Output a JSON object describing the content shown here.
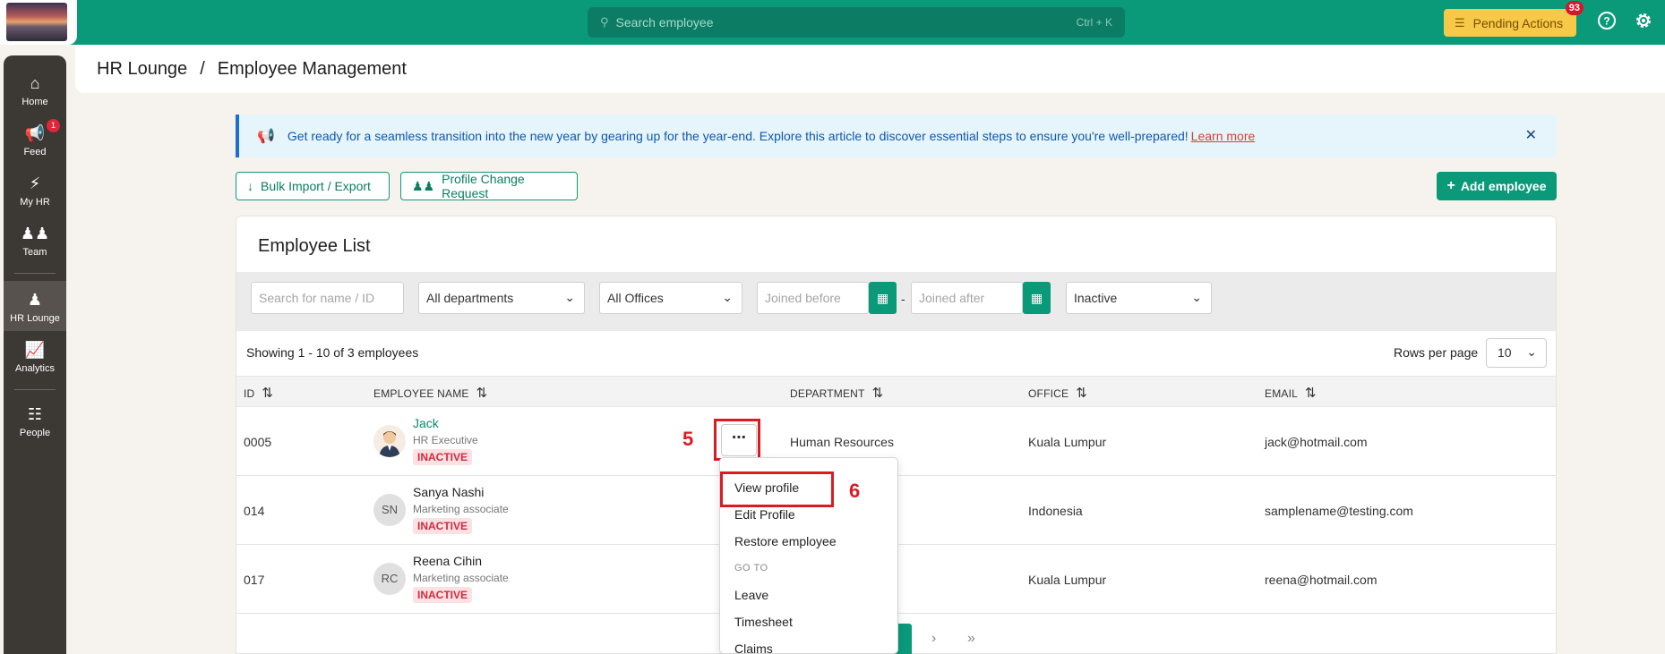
{
  "topbar": {
    "search_placeholder": "Search employee",
    "search_shortcut": "Ctrl + K",
    "pending_label": "Pending Actions",
    "pending_count": "93"
  },
  "sidebar": {
    "items": [
      {
        "label": "Home",
        "icon": "home-icon"
      },
      {
        "label": "Feed",
        "icon": "megaphone-icon",
        "badge": "1"
      },
      {
        "label": "My HR",
        "icon": "bolt-icon"
      },
      {
        "label": "Team",
        "icon": "team-icon"
      },
      {
        "label": "HR Lounge",
        "icon": "user-gear-icon",
        "active": true
      },
      {
        "label": "Analytics",
        "icon": "chart-icon"
      },
      {
        "label": "People",
        "icon": "org-chart-icon"
      }
    ]
  },
  "breadcrumb": {
    "root": "HR Lounge",
    "sep": "/",
    "current": "Employee Management"
  },
  "banner": {
    "text": "Get ready for a seamless transition into the new year by gearing up for the year-end. Explore this article to discover essential steps to ensure you're well-prepared!",
    "link": "Learn more"
  },
  "toolbar": {
    "bulk_label": "Bulk Import / Export",
    "profile_change_label": "Profile Change Request",
    "add_label": "Add employee"
  },
  "list": {
    "title": "Employee List",
    "filters": {
      "search_placeholder": "Search for name / ID",
      "department": "All departments",
      "office": "All Offices",
      "joined_before": "Joined before",
      "joined_after": "Joined after",
      "date_sep": "-",
      "status": "Inactive"
    },
    "showing": "Showing 1 - 10 of 3 employees",
    "rows_per_page_label": "Rows per page",
    "rows_per_page": "10",
    "columns": [
      "ID",
      "EMPLOYEE NAME",
      "DEPARTMENT",
      "OFFICE",
      "EMAIL"
    ],
    "rows": [
      {
        "id": "0005",
        "name": "Jack",
        "role": "HR Executive",
        "status": "INACTIVE",
        "initials": "",
        "department": "Human Resources",
        "office": "Kuala Lumpur",
        "email": "jack@hotmail.com"
      },
      {
        "id": "014",
        "name": "Sanya Nashi",
        "role": "Marketing associate",
        "status": "INACTIVE",
        "initials": "SN",
        "department": "",
        "office": "Indonesia",
        "email": "samplename@testing.com"
      },
      {
        "id": "017",
        "name": "Reena Cihin",
        "role": "Marketing associate",
        "status": "INACTIVE",
        "initials": "RC",
        "department": "",
        "office": "Kuala Lumpur",
        "email": "reena@hotmail.com"
      }
    ]
  },
  "row_menu": {
    "items": [
      "View profile",
      "Edit Profile",
      "Restore employee"
    ],
    "section": "GO TO",
    "goto": [
      "Leave",
      "Timesheet",
      "Claims"
    ]
  },
  "annotations": {
    "step5": "5",
    "step6": "6"
  },
  "colors": {
    "brand": "#0a9a7a",
    "highlight": "#d91c24"
  }
}
